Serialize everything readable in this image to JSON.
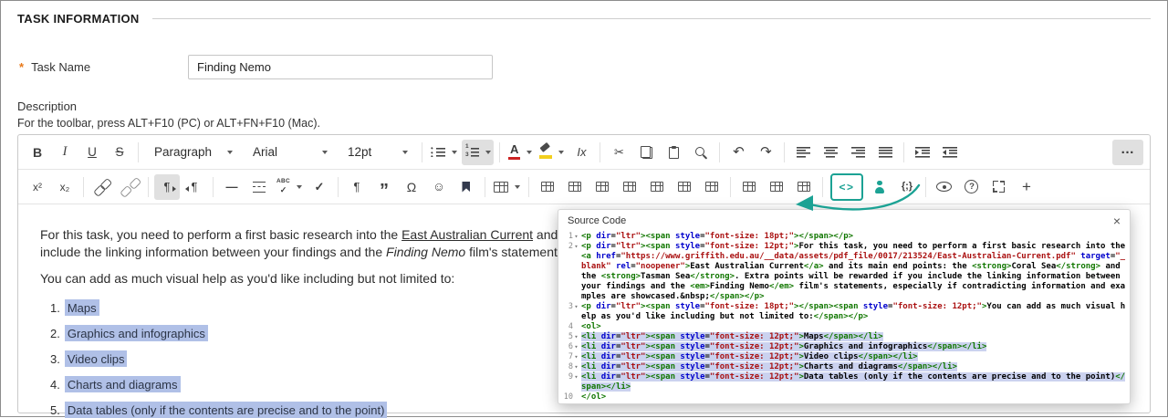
{
  "colors": {
    "accent_teal": "#1ba294",
    "required_orange": "#e8791a",
    "editor_selection": "#b0c0e7",
    "code_selection": "#cbd2ef",
    "code_tag": "#117700",
    "code_attr": "#0000cc",
    "code_string": "#aa1111"
  },
  "page": {
    "title": "TASK INFORMATION"
  },
  "form": {
    "required_marker": "*",
    "task_name_label": "Task Name",
    "task_name_value": "Finding Nemo",
    "description_label": "Description",
    "toolbar_hint": "For the toolbar, press ALT+F10 (PC) or ALT+FN+F10 (Mac)."
  },
  "icons": {
    "bold-icon": "B",
    "italic-icon": "I",
    "underline-icon": "U",
    "strikethrough-icon": "S",
    "bullet-list-icon": "",
    "numbered-list-icon": "",
    "text-color-icon": "A",
    "highlight-icon": "",
    "clear-formatting-icon": "Ix",
    "cut-icon": "✂",
    "copy-icon": "",
    "paste-icon": "",
    "search-icon": "",
    "undo-icon": "↶",
    "redo-icon": "↷",
    "align-left-icon": "",
    "align-center-icon": "",
    "align-right-icon": "",
    "align-justify-icon": "",
    "indent-icon": "",
    "outdent-icon": "",
    "more-icon": "…",
    "superscript-icon": "x²",
    "subscript-icon": "x₂",
    "link-icon": "",
    "unlink-icon": "",
    "ltr-icon": "¶",
    "rtl-icon": "¶",
    "horizontal-rule-icon": "—",
    "page-break-icon": "",
    "spellcheck-icon": "✓",
    "checkmark-icon": "✓",
    "pilcrow-icon": "¶",
    "blockquote-ic": "",
    "blockquote-icon": "”",
    "omega-icon": "Ω",
    "emoticon-icon": "☺",
    "anchor-icon": "",
    "table-icon": "",
    "grid-icon": "",
    "source-code-icon": "<>",
    "accessibility-icon": "",
    "code-sample-icon": "{;}",
    "preview-icon": "",
    "help-icon": "?",
    "fullscreen-icon": "",
    "add-icon": "+",
    "fold-icon": "▾",
    "chevron-down-icon": "▾"
  },
  "toolbar": {
    "row1": [
      {
        "name": "bold-button",
        "icon": "bold-icon"
      },
      {
        "name": "italic-button",
        "icon": "italic-icon"
      },
      {
        "name": "underline-button",
        "icon": "underline-icon"
      },
      {
        "name": "strikethrough-button",
        "icon": "strikethrough-icon"
      },
      {
        "sep": true
      },
      {
        "name": "paragraph-format-select",
        "label": "Paragraph",
        "select": true
      },
      {
        "name": "font-family-select",
        "label": "Arial",
        "select": true
      },
      {
        "name": "font-size-select",
        "label": "12pt",
        "select": true
      },
      {
        "sep": true
      },
      {
        "name": "bullet-list-button",
        "icon": "bullet-list-icon",
        "split": true
      },
      {
        "name": "numbered-list-button",
        "icon": "numbered-list-icon",
        "split": true,
        "active": true
      },
      {
        "sep": true
      },
      {
        "name": "text-color-button",
        "icon": "text-color-icon",
        "split": true
      },
      {
        "name": "highlight-color-button",
        "icon": "highlight-icon",
        "split": true
      },
      {
        "name": "clear-formatting-button",
        "icon": "clear-formatting-icon"
      },
      {
        "sep": true
      },
      {
        "name": "cut-button",
        "icon": "cut-icon"
      },
      {
        "name": "copy-button",
        "icon": "copy-icon"
      },
      {
        "name": "paste-button",
        "icon": "paste-icon"
      },
      {
        "name": "search-button",
        "icon": "search-icon"
      },
      {
        "sep": true
      },
      {
        "name": "undo-button",
        "icon": "undo-icon"
      },
      {
        "name": "redo-button",
        "icon": "redo-icon"
      },
      {
        "sep": true
      },
      {
        "name": "align-left-button",
        "icon": "align-left-icon"
      },
      {
        "name": "align-center-button",
        "icon": "align-center-icon"
      },
      {
        "name": "align-right-button",
        "icon": "align-right-icon"
      },
      {
        "name": "align-justify-button",
        "icon": "align-justify-icon"
      },
      {
        "sep": true
      },
      {
        "name": "indent-button",
        "icon": "indent-icon"
      },
      {
        "name": "outdent-button",
        "icon": "outdent-icon"
      },
      {
        "spacer": true
      },
      {
        "name": "more-toolbar-button",
        "icon": "more-icon",
        "active": true
      }
    ],
    "row2": [
      {
        "name": "superscript-button",
        "icon": "superscript-icon"
      },
      {
        "name": "subscript-button",
        "icon": "subscript-icon"
      },
      {
        "sep": true
      },
      {
        "name": "insert-link-button",
        "icon": "link-icon"
      },
      {
        "name": "remove-link-button",
        "icon": "unlink-icon"
      },
      {
        "sep": true
      },
      {
        "name": "ltr-direction-button",
        "icon": "ltr-icon",
        "active": true
      },
      {
        "name": "rtl-direction-button",
        "icon": "rtl-icon"
      },
      {
        "sep": true
      },
      {
        "name": "horizontal-rule-button",
        "icon": "horizontal-rule-icon"
      },
      {
        "name": "page-break-button",
        "icon": "page-break-icon"
      },
      {
        "name": "spellcheck-button",
        "icon": "spellcheck-icon",
        "split": true
      },
      {
        "name": "checkmark-button",
        "icon": "checkmark-icon"
      },
      {
        "sep": true
      },
      {
        "name": "show-invisibles-button",
        "icon": "pilcrow-icon"
      },
      {
        "name": "blockquote-button",
        "icon": "blockquote-icon"
      },
      {
        "name": "special-character-button",
        "icon": "omega-icon"
      },
      {
        "name": "emoticon-button",
        "icon": "emoticon-icon"
      },
      {
        "name": "anchor-button",
        "icon": "anchor-icon"
      },
      {
        "sep": true
      },
      {
        "name": "insert-table-button",
        "icon": "table-icon",
        "split": true
      },
      {
        "sep": true
      },
      {
        "name": "delete-table-button",
        "icon": "grid-icon"
      },
      {
        "name": "cell-properties-button",
        "icon": "grid-icon"
      },
      {
        "name": "merge-cells-button",
        "icon": "grid-icon"
      },
      {
        "name": "split-cell-button",
        "icon": "grid-icon"
      },
      {
        "name": "insert-row-above-button",
        "icon": "grid-icon"
      },
      {
        "name": "insert-row-below-button",
        "icon": "grid-icon"
      },
      {
        "name": "delete-row-button",
        "icon": "grid-icon"
      },
      {
        "sep": true
      },
      {
        "name": "insert-column-left-button",
        "icon": "grid-icon"
      },
      {
        "name": "insert-column-right-button",
        "icon": "grid-icon"
      },
      {
        "name": "delete-column-button",
        "icon": "grid-icon"
      },
      {
        "sep": true
      },
      {
        "name": "source-code-button",
        "icon": "source-code-icon",
        "accent": true
      },
      {
        "name": "accessibility-checker-button",
        "icon": "accessibility-icon"
      },
      {
        "name": "code-sample-button",
        "icon": "code-sample-icon"
      },
      {
        "sep": true
      },
      {
        "name": "preview-button",
        "icon": "preview-icon"
      },
      {
        "name": "help-button",
        "icon": "help-icon"
      },
      {
        "name": "fullscreen-button",
        "icon": "fullscreen-icon"
      },
      {
        "name": "add-content-button",
        "icon": "add-icon"
      }
    ]
  },
  "editor": {
    "paragraph1_lines": [
      [
        {
          "text": "For this task, you need to perform a first basic research into the "
        },
        {
          "text": "East Australian Current",
          "format": "link"
        },
        {
          "text": " and"
        }
      ],
      [
        {
          "text": "include the linking information between your findings and the "
        },
        {
          "text": "Finding Nemo",
          "format": "italic"
        },
        {
          "text": " film's statement"
        }
      ]
    ],
    "paragraph2": "You can add as much visual help as you'd like including but not limited to:",
    "list": [
      {
        "number": "1.",
        "text": "Maps"
      },
      {
        "number": "2.",
        "text": "Graphics and infographics"
      },
      {
        "number": "3.",
        "text": "Video clips"
      },
      {
        "number": "4.",
        "text": "Charts and diagrams"
      },
      {
        "number": "5.",
        "text": "Data tables (only if the contents are precise and to the point)"
      }
    ]
  },
  "source_dialog": {
    "title": "Source Code",
    "close_label": "×",
    "lines": [
      {
        "n": 1,
        "fold": true,
        "code": "<p dir=\"ltr\"><span style=\"font-size: 18pt;\"></span></p>"
      },
      {
        "n": 2,
        "fold": true,
        "code": "<p dir=\"ltr\"><span style=\"font-size: 12pt;\">For this task, you need to perform a first basic research into the <a href=\"https://www.griffith.edu.au/__data/assets/pdf_file/0017/213524/East-Australian-Current.pdf\" target=\"_blank\" rel=\"noopener\">East Australian Current</a> and its main end points: the <strong>Coral Sea</strong> and the <strong>Tasman Sea</strong>. Extra points will be rewarded if you include the linking information between your findings and the <em>Finding Nemo</em> film's statements, especially if contradicting information and examples are showcased.&nbsp;</span></p>"
      },
      {
        "n": 3,
        "fold": true,
        "code": "<p dir=\"ltr\"><span style=\"font-size: 18pt;\"></span><span style=\"font-size: 12pt;\">You can add as much visual help as you'd like including but not limited to:</span></p>"
      },
      {
        "n": 4,
        "fold": false,
        "code": "<ol>"
      },
      {
        "n": 5,
        "fold": true,
        "selected": true,
        "code": "<li dir=\"ltr\"><span style=\"font-size: 12pt;\">Maps</span></li>"
      },
      {
        "n": 6,
        "fold": true,
        "selected": true,
        "code": "<li dir=\"ltr\"><span style=\"font-size: 12pt;\">Graphics and infographics</span></li>"
      },
      {
        "n": 7,
        "fold": true,
        "selected": true,
        "code": "<li dir=\"ltr\"><span style=\"font-size: 12pt;\">Video clips</span></li>"
      },
      {
        "n": 8,
        "fold": true,
        "selected": true,
        "code": "<li dir=\"ltr\"><span style=\"font-size: 12pt;\">Charts and diagrams</span></li>"
      },
      {
        "n": 9,
        "fold": true,
        "selected": true,
        "code": "<li dir=\"ltr\"><span style=\"font-size: 12pt;\">Data tables (only if the contents are precise and to the point)</span></li>"
      },
      {
        "n": 10,
        "fold": false,
        "code": "</ol>"
      }
    ]
  }
}
